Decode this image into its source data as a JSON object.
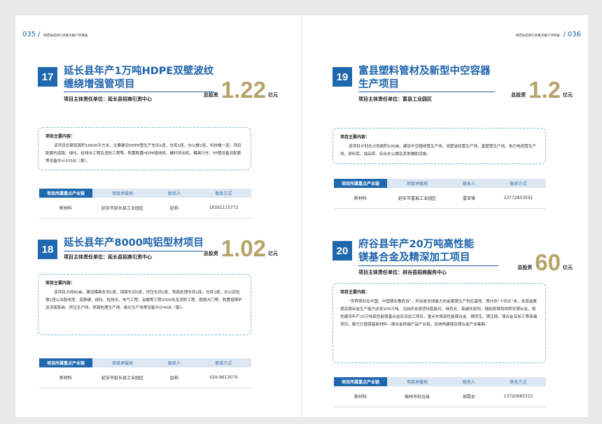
{
  "header": {
    "left_page_number": "035",
    "right_page_number": "036",
    "running_title": "陕西省招商引资重点推介项目册"
  },
  "table_headers": [
    "项目所属重点产业链",
    "项目承载地",
    "联系人",
    "联系方式"
  ],
  "projects": [
    {
      "number": "17",
      "title_line1": "延长县年产1万吨HDPE双壁波纹",
      "title_line2": "缠绕增强管项目",
      "responsible": "项目主体责任单位：延长县招商引资中心",
      "invest_label": "总投资",
      "amount": "1.22",
      "unit": "亿元",
      "content_title": "项目主要内容：",
      "content": "该项目总建筑面积16600平方米，主要建设HDPE管生产车间1座，仓库1座，办公楼1座，科技楼一座，项目配套的道路、绿化、给排水工程及消防工程等。购置购置HDPE缠绕机、螺杆挤出机、模具行车、PP管设备及配套等设备共计103台（套）。",
      "row": [
        "新材料",
        "延安市延长县工业园区",
        "赵莉",
        "18391115772"
      ]
    },
    {
      "number": "18",
      "title_line1": "延长县年产8000吨铝型材项目",
      "title_line2": "",
      "responsible": "项目主体责任单位：延长县招商引资中心",
      "invest_label": "总投资",
      "amount": "1.02",
      "unit": "亿元",
      "content_title": "项目主要内容：",
      "content": "该项目占地80亩，建设模具车间1座，熔铸车间1座，挤压车间1座，表面处理车间1座，仓库1座，办公实验楼1座以及配电室、道路硬、绿化、给排水、电气工程、采暖等工程2000米及消防工程、围墙大门等。购置熔铸炉及浇铸系统、挤压生产线、表面处理生产线、氧化生产线等设备共计40台（套）。",
      "row": [
        "新材料",
        "延安市延长县工业园区",
        "赵莉",
        "029-8613076"
      ]
    },
    {
      "number": "19",
      "title_line1": "富县塑料管材及新型中空容器",
      "title_line2": "生产项目",
      "responsible": "项目主体责任单位：富县工业园区",
      "invest_label": "总投资",
      "amount": "1.2",
      "unit": "亿元",
      "content_title": "项目主要内容：",
      "content": "该项目计划总占地面积100亩，建设中空缠绕管生产线、双壁波纹管生产线、直壁管生产线、电力电缆管生产线，原料库、成品库、综合办公楼及其他辅助设施。",
      "row": [
        "新材料",
        "延安市富县工业园区",
        "雷亚锋",
        "13772853591"
      ]
    },
    {
      "number": "20",
      "title_line1": "府谷县年产20万吨高性能",
      "title_line2": "镁基合金及精深加工项目",
      "responsible": "项目主体责任单位：府谷县招商服务中心",
      "invest_label": "总投资",
      "amount": "60",
      "unit": "亿元",
      "content_title": "项目主要内容：",
      "content": "“世界镁业在中国，中国镁业看府谷”，府谷是全球最大的金属镁生产供应基地。预计到“十四五”末，全县金属镁及镁合金生产能力达到100万吨。当前府谷县坚持智能化、绿色化、高端化原则，鼓励原镁就地转化镁合金，规划建设年产20万吨高性能镁基合金及深加工项目，重点布局高性能镁合金、镁挤压、镁压铸、镁合金深加工等高端项目，聚力打造镁基新材料—镁合金终端产品产业链，加快构建镁及镁合金产业集群。",
      "row": [
        "新材料",
        "榆林市府谷县",
        "郝霞女",
        "13720685315"
      ]
    }
  ]
}
